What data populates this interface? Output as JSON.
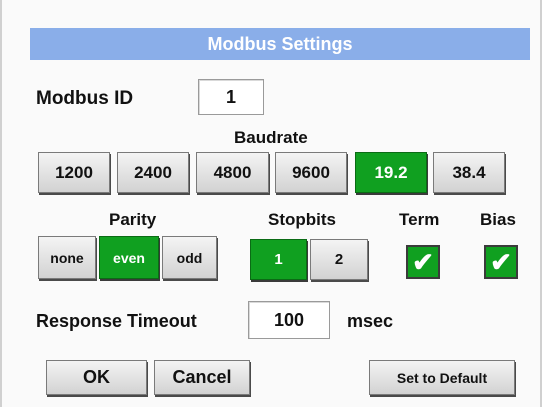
{
  "title": "Modbus Settings",
  "modbus_id": {
    "label": "Modbus ID",
    "value": "1"
  },
  "baudrate": {
    "label": "Baudrate",
    "options": [
      "1200",
      "2400",
      "4800",
      "9600",
      "19.2",
      "38.4"
    ],
    "selected": "19.2"
  },
  "parity": {
    "label": "Parity",
    "options": [
      "none",
      "even",
      "odd"
    ],
    "selected": "even"
  },
  "stopbits": {
    "label": "Stopbits",
    "options": [
      "1",
      "2"
    ],
    "selected": "1"
  },
  "term": {
    "label": "Term",
    "checked": true,
    "mark": "✔"
  },
  "bias": {
    "label": "Bias",
    "checked": true,
    "mark": "✔"
  },
  "response_timeout": {
    "label": "Response Timeout",
    "value": "100",
    "unit": "msec"
  },
  "buttons": {
    "ok": "OK",
    "cancel": "Cancel",
    "default": "Set to Default"
  },
  "colors": {
    "title_bar": "#8aaee9",
    "selected": "#10a020"
  }
}
